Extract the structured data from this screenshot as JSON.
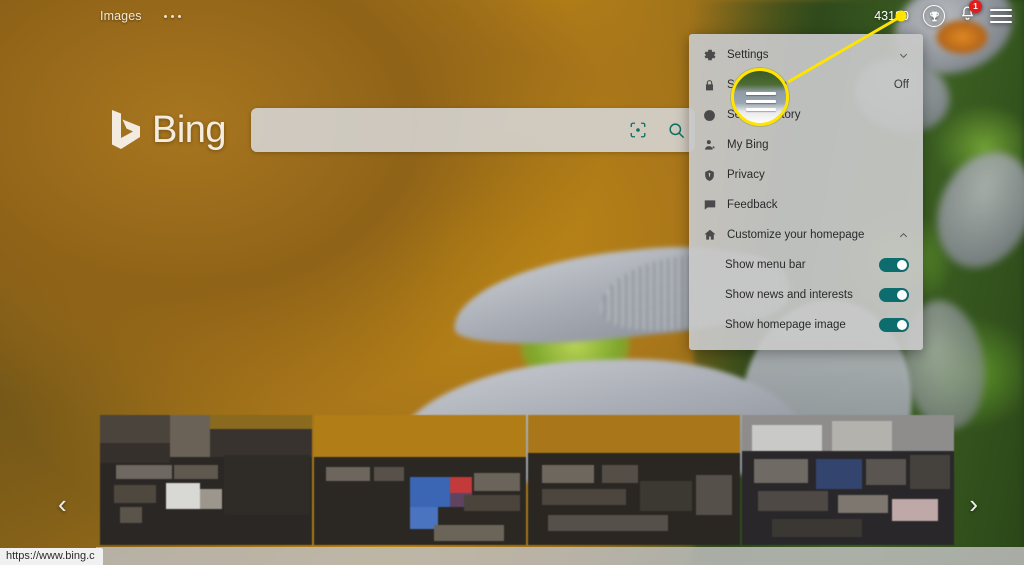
{
  "topbar": {
    "images_label": "Images",
    "more_icon": "ellipsis-icon",
    "points": "43180",
    "rewards_icon": "rewards-trophy-icon",
    "notification_icon": "bell-icon",
    "notification_count": "1",
    "menu_icon": "hamburger-menu-icon"
  },
  "hero": {
    "logo_text": "Bing",
    "logo_icon": "bing-logo-icon",
    "search_value": "",
    "search_placeholder": "",
    "visual_search_icon": "visual-search-icon",
    "search_icon": "search-icon"
  },
  "panel": {
    "items": [
      {
        "label": "Settings",
        "icon": "gear-icon",
        "value": "",
        "chevron": "⌄",
        "type": "expandable"
      },
      {
        "label": "SafeSearch",
        "icon": "lock-icon",
        "value": "Off",
        "chevron": "",
        "type": "value"
      },
      {
        "label": "Search history",
        "icon": "clock-icon",
        "value": "",
        "chevron": "",
        "type": "link"
      },
      {
        "label": "My Bing",
        "icon": "person-icon",
        "value": "",
        "chevron": "",
        "type": "link"
      },
      {
        "label": "Privacy",
        "icon": "shield-icon",
        "value": "",
        "chevron": "",
        "type": "link"
      },
      {
        "label": "Feedback",
        "icon": "feedback-icon",
        "value": "",
        "chevron": "",
        "type": "link"
      },
      {
        "label": "Customize your homepage",
        "icon": "home-icon",
        "value": "",
        "chevron": "⌃",
        "type": "expandable"
      }
    ],
    "toggles": [
      {
        "label": "Show menu bar",
        "state": "on"
      },
      {
        "label": "Show news and interests",
        "state": "on"
      },
      {
        "label": "Show homepage image",
        "state": "on"
      }
    ]
  },
  "carousel": {
    "prev_icon": "chevron-left-icon",
    "next_icon": "chevron-right-icon"
  },
  "statusbar": {
    "url": "https://www.bing.c"
  },
  "colors": {
    "toggle_on": "#0d6c6e",
    "callout": "#ffe400",
    "badge": "#e21b1b",
    "panel_bg": "#c8c8c8",
    "search_bg": "#d6d6d6"
  }
}
